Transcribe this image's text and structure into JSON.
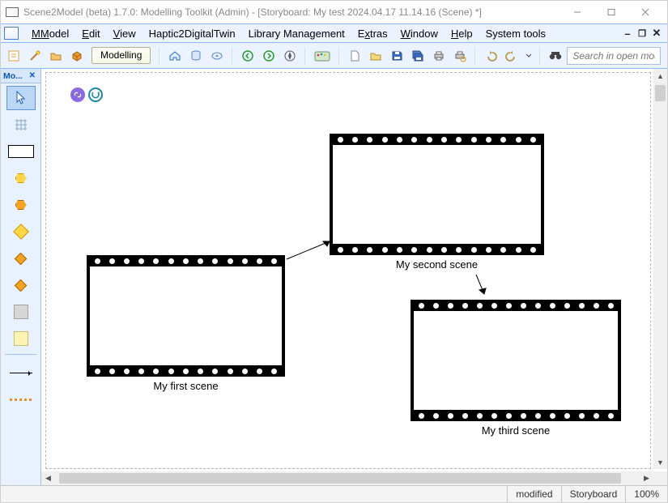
{
  "title": "Scene2Model (beta) 1.7.0: Modelling Toolkit (Admin) - [Storyboard: My test 2024.04.17 11.14.16 (Scene) *]",
  "menus": {
    "model": "Model",
    "edit": "Edit",
    "view": "View",
    "haptic": "Haptic2DigitalTwin",
    "library": "Library Management",
    "extras": "Extras",
    "window": "Window",
    "help": "Help",
    "system": "System tools"
  },
  "toolbar": {
    "mode_label": "Modelling",
    "search_placeholder": "Search in open models"
  },
  "palette": {
    "title": "Mo..."
  },
  "scenes": [
    {
      "label": "My first scene"
    },
    {
      "label": "My second scene"
    },
    {
      "label": "My third scene"
    }
  ],
  "status": {
    "modified": "modified",
    "mode": "Storyboard",
    "zoom": "100%"
  }
}
